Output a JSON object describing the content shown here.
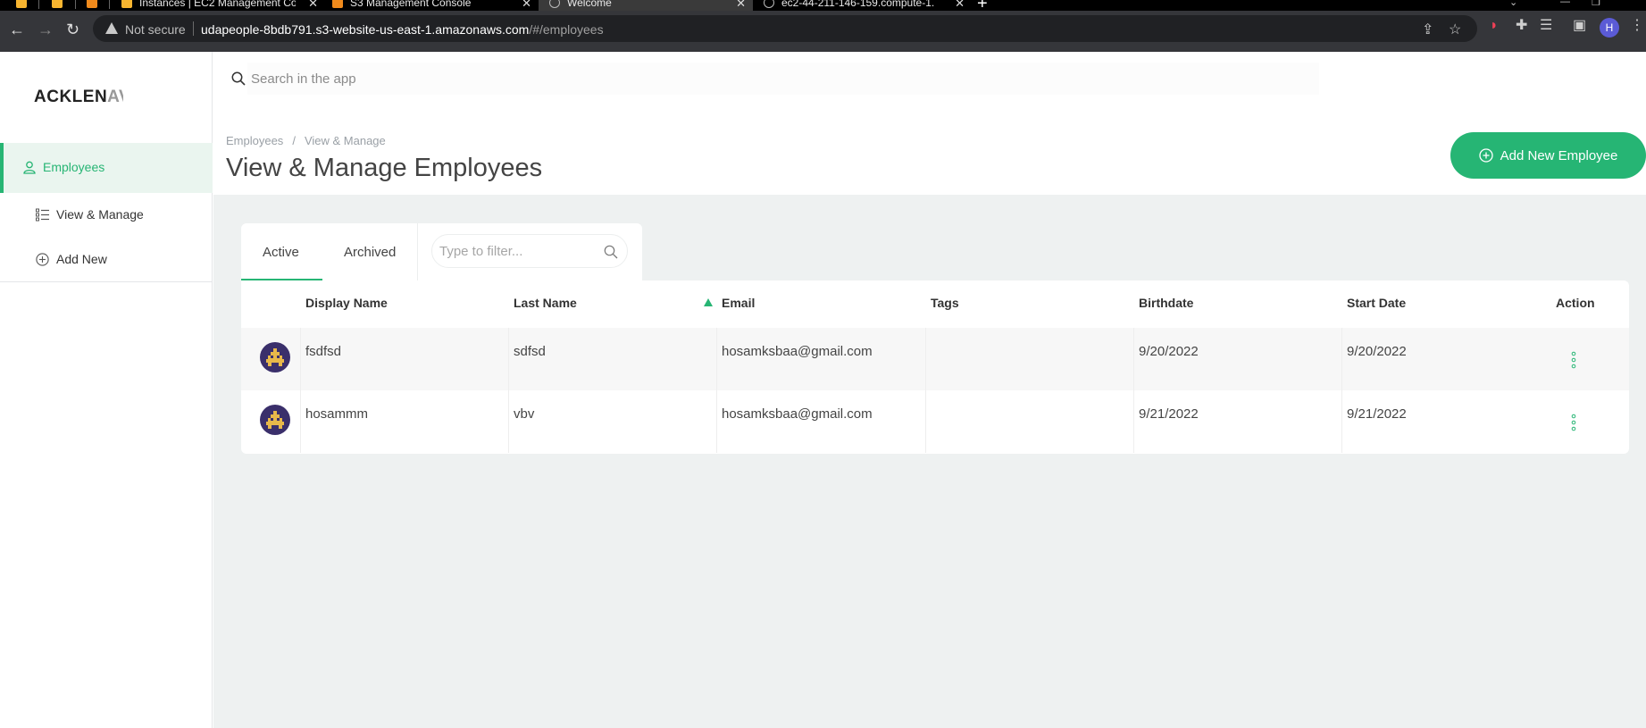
{
  "browser": {
    "tabs": [
      {
        "title": "",
        "icon": "aws-icon"
      },
      {
        "title": "",
        "icon": "aws-icon"
      },
      {
        "title": "",
        "icon": "aws-icon"
      },
      {
        "title": "Instances | EC2 Management Co",
        "icon": "aws-icon"
      },
      {
        "title": "S3 Management Console",
        "icon": "aws-icon"
      },
      {
        "title": "Welcome",
        "icon": "globe-icon",
        "active": true
      },
      {
        "title": "ec2-44-211-146-159.compute-1.",
        "icon": "globe-icon"
      }
    ],
    "security_label": "Not secure",
    "url_host": "udapeople-8bdb791.s3-website-us-east-1.amazonaws.com",
    "url_path": "/#/employees",
    "profile_initial": "H"
  },
  "app": {
    "logo": "ACKLEN",
    "logo_fade": "AV",
    "search_placeholder": "Search in the app",
    "sidebar": {
      "section": "Employees",
      "items": [
        {
          "label": "View & Manage",
          "icon": "list-icon"
        },
        {
          "label": "Add New",
          "icon": "plus-circle-icon"
        }
      ]
    },
    "breadcrumb": [
      "Employees",
      "View & Manage"
    ],
    "breadcrumb_sep": "/",
    "page_title": "View & Manage Employees",
    "add_button": "Add New Employee",
    "filter_tabs": [
      {
        "label": "Active",
        "active": true
      },
      {
        "label": "Archived",
        "active": false
      }
    ],
    "filter_placeholder": "Type to filter...",
    "table": {
      "columns": [
        "Display Name",
        "Last Name",
        "Email",
        "Tags",
        "Birthdate",
        "Start Date",
        "Action"
      ],
      "sorted_column": "Email",
      "rows": [
        {
          "display_name": "fsdfsd",
          "last_name": "sdfsd",
          "email": "hosamksbaa@gmail.com",
          "tags": "",
          "birthdate": "9/20/2022",
          "start_date": "9/20/2022"
        },
        {
          "display_name": "hosammm",
          "last_name": "vbv",
          "email": "hosamksbaa@gmail.com",
          "tags": "",
          "birthdate": "9/21/2022",
          "start_date": "9/21/2022"
        }
      ]
    }
  },
  "colors": {
    "accent": "#27b574",
    "browser_bg": "#35363a",
    "content_bg": "#eef1f1"
  }
}
